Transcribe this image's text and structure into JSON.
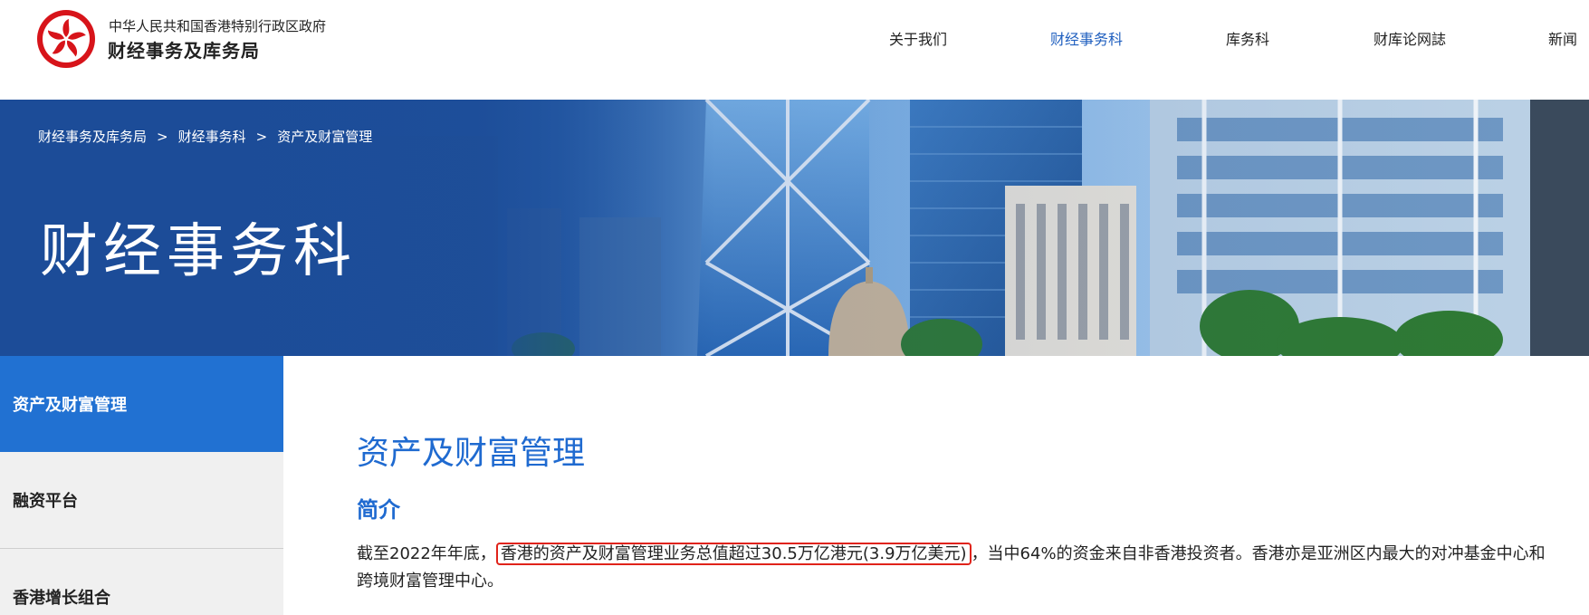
{
  "header": {
    "org_line1": "中华人民共和国香港特别行政区政府",
    "org_line2": "财经事务及库务局",
    "logo_icon": "bauhinia-emblem-icon",
    "nav": [
      {
        "label": "关于我们",
        "active": false
      },
      {
        "label": "财经事务科",
        "active": true
      },
      {
        "label": "库务科",
        "active": false
      },
      {
        "label": "财库论网誌",
        "active": false
      },
      {
        "label": "新闻",
        "active": false
      }
    ]
  },
  "banner": {
    "breadcrumb": [
      "财经事务及库务局",
      "财经事务科",
      "资产及财富管理"
    ],
    "separator": ">",
    "title": "财经事务科"
  },
  "sidebar": {
    "items": [
      {
        "label": "资产及财富管理",
        "active": true
      },
      {
        "label": "融资平台",
        "active": false
      },
      {
        "label": "香港增长组合",
        "active": false
      }
    ]
  },
  "main": {
    "title": "资产及财富管理",
    "subtitle": "简介",
    "para_before": "截至2022年年底，",
    "para_highlight": "香港的资产及财富管理业务总值超过30.5万亿港元(3.9万亿美元)",
    "para_after": "，当中64%的资金来自非香港投资者。香港亦是亚洲区内最大的对冲基金中心和跨境财富管理中心。"
  },
  "colors": {
    "accent": "#1f6ad0",
    "sidebar_active": "#2171d2",
    "highlight_border": "#e0231a",
    "banner_overlay": "#1d4f9a"
  }
}
